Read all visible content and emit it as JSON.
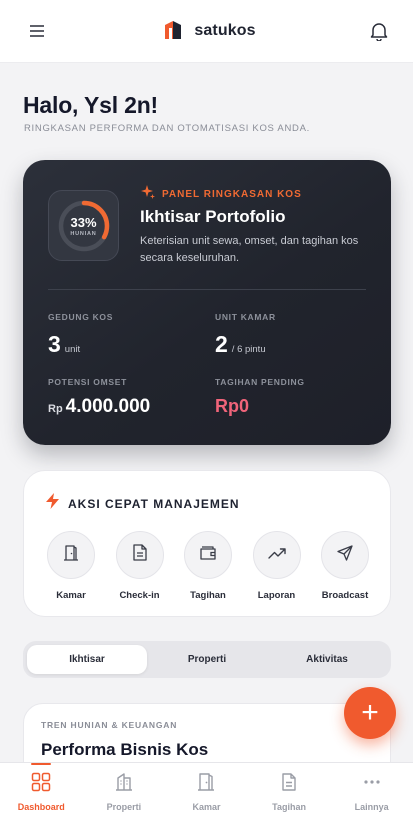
{
  "header": {
    "menu_icon": "hamburger-icon",
    "brand_name": "satukos",
    "logo_icon": "satukos-logo",
    "notification_icon": "bell-icon"
  },
  "greeting": {
    "title": "Halo, Ysl 2n!",
    "subtitle": "RINGKASAN PERFORMA DAN OTOMATISASI KOS ANDA."
  },
  "portfolio": {
    "occupancy_percent": 33,
    "occupancy_text": "33%",
    "occupancy_label": "HUNIAN",
    "tag": "PANEL RINGKASAN KOS",
    "title": "Ikhtisar Portofolio",
    "description": "Keterisian unit sewa, omset, dan tagihan kos secara keseluruhan.",
    "stats": {
      "buildings": {
        "label": "GEDUNG KOS",
        "value": "3",
        "unit": "unit"
      },
      "rooms": {
        "label": "UNIT KAMAR",
        "value": "2",
        "unit": "/ 6 pintu"
      },
      "revenue": {
        "label": "POTENSI OMSET",
        "prefix": "Rp",
        "value": "4.000.000"
      },
      "pending": {
        "label": "TAGIHAN PENDING",
        "value": "Rp0"
      }
    },
    "colors": {
      "accent": "#f06a33",
      "pending": "#f0647a",
      "card_bg": "#262932"
    }
  },
  "quick_actions": {
    "title": "AKSI CEPAT MANAJEMEN",
    "items": [
      {
        "label": "Kamar",
        "icon": "door-icon"
      },
      {
        "label": "Check-in",
        "icon": "document-icon"
      },
      {
        "label": "Tagihan",
        "icon": "wallet-icon"
      },
      {
        "label": "Laporan",
        "icon": "trend-up-icon"
      },
      {
        "label": "Broadcast",
        "icon": "send-icon"
      }
    ]
  },
  "tabs": {
    "items": [
      "Ikhtisar",
      "Properti",
      "Aktivitas"
    ],
    "active": "Ikhtisar"
  },
  "trend": {
    "tag": "TREN HUNIAN & KEUANGAN",
    "title": "Performa Bisnis Kos"
  },
  "fab": {
    "label": "+",
    "icon": "plus-icon",
    "color": "#f05a2e"
  },
  "bottom_nav": {
    "active": "Dashboard",
    "items": [
      {
        "label": "Dashboard",
        "icon": "dashboard-icon"
      },
      {
        "label": "Properti",
        "icon": "building-icon"
      },
      {
        "label": "Kamar",
        "icon": "door-icon"
      },
      {
        "label": "Tagihan",
        "icon": "document-icon"
      },
      {
        "label": "Lainnya",
        "icon": "more-icon"
      }
    ]
  }
}
